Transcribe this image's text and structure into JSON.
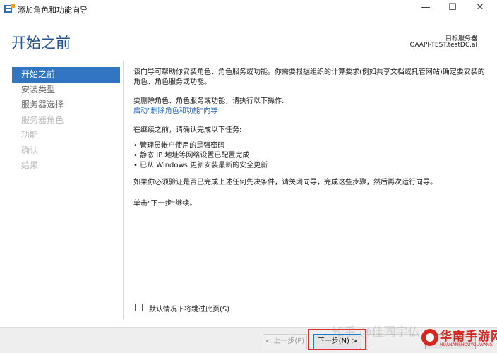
{
  "window": {
    "title": "添加角色和功能向导",
    "minimize_glyph": "—",
    "maximize_glyph": "☐",
    "close_glyph": "✕",
    "app_icon": "server-manager-icon"
  },
  "header": {
    "page_title": "开始之前",
    "destination_label": "目标服务器",
    "destination_server": "OAAPI-TEST.testDC.al"
  },
  "nav": {
    "items": [
      {
        "label": "开始之前",
        "state": "active"
      },
      {
        "label": "安装类型",
        "state": "normal"
      },
      {
        "label": "服务器选择",
        "state": "normal"
      },
      {
        "label": "服务器角色",
        "state": "disabled"
      },
      {
        "label": "功能",
        "state": "disabled"
      },
      {
        "label": "确认",
        "state": "disabled"
      },
      {
        "label": "结果",
        "state": "disabled"
      }
    ]
  },
  "content": {
    "intro": "该向导可帮助你安装角色、角色服务或功能。你需要根据组织的计算要求(例如共享文档或托管网站)确定要安装的角色、角色服务或功能。",
    "remove_text": "要删除角色、角色服务或功能，请执行以下操作:",
    "remove_link": "启动\"删除角色和功能\"向导",
    "before_text": "在继续之前，请确认完成以下任务:",
    "bullets": [
      "• 管理员帐户使用的是强密码",
      "• 静态 IP 地址等网络设置已配置完成",
      "• 已从 Windows 更新安装最新的安全更新"
    ],
    "verify_text": "如果你必须验证是否已完成上述任何先决条件，请关闭向导，完成这些步骤，然后再次运行向导。",
    "click_next_text": "单击\"下一步\"继续。"
  },
  "skip_checkbox": {
    "label": "默认情况下将跳过此页(S)",
    "checked": false
  },
  "footer": {
    "prev_label": "< 上一步(P)",
    "next_label": "下一步(N) >",
    "install_label": "",
    "cancel_label": ""
  },
  "watermark": {
    "text": "知乎 @佳同宇仏",
    "logo_main": "华南手游网",
    "logo_sub": "HUANANSHOUYOUWANG"
  },
  "colors": {
    "accent": "#3276c3",
    "title_blue": "#26548f",
    "link": "#1b63b5",
    "highlight": "#e03030",
    "logo_red": "#d8261f"
  }
}
